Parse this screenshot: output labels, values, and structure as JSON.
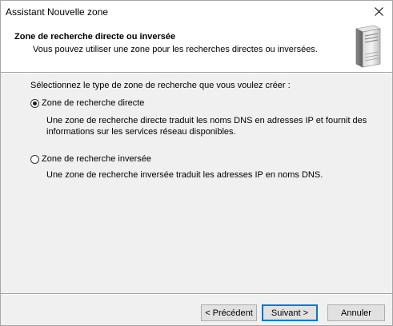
{
  "window": {
    "title": "Assistant Nouvelle zone",
    "close_icon": "close-icon"
  },
  "header": {
    "title": "Zone de recherche directe ou inversée",
    "subtitle": "Vous pouvez utiliser une zone pour les recherches directes ou inversées.",
    "icon": "server-icon"
  },
  "content": {
    "prompt": "Sélectionnez le type de zone de recherche que vous voulez créer :",
    "options": [
      {
        "label": "Zone de recherche directe",
        "checked": true,
        "description_lines": [
          "Une zone de recherche directe traduit les noms DNS en adresses IP et fournit des",
          "informations sur les services réseau disponibles."
        ]
      },
      {
        "label": "Zone de recherche inversée",
        "checked": false,
        "description_lines": [
          "Une zone de recherche inversée traduit les adresses IP en noms DNS."
        ]
      }
    ]
  },
  "footer": {
    "back_label": "< Précédent",
    "next_label": "Suivant >",
    "cancel_label": "Annuler"
  }
}
